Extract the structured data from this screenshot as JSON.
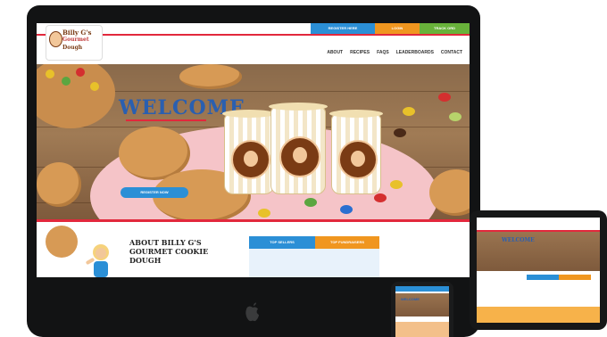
{
  "colors": {
    "brand_red": "#e2283c",
    "brand_blue": "#2b8fd6",
    "brand_orange": "#f0961f",
    "brand_green": "#68b23a",
    "wood": "#8a6a4b"
  },
  "site": {
    "logo": {
      "line1": "Billy G's",
      "line2": "Gourmet",
      "line3": "Dough"
    },
    "topbar": {
      "register": "REGISTER HERE",
      "login": "LOGIN",
      "track": "TRACK ORD"
    },
    "nav": [
      "ABOUT",
      "RECIPES",
      "FAQS",
      "LEADERBOARDS",
      "CONTACT"
    ],
    "hero": {
      "title": "WELCOME",
      "button": "REGISTER NOW"
    },
    "about": {
      "title": "ABOUT BILLY G'S GOURMET COOKIE DOUGH",
      "tab1": "TOP SELLERS",
      "tab2": "TOP FUNDRAISERS"
    }
  },
  "tablet": {
    "welcome": "WELCOME"
  },
  "phone": {
    "welcome": "WELCOME"
  },
  "icons": {
    "device_logo": "apple-icon"
  }
}
